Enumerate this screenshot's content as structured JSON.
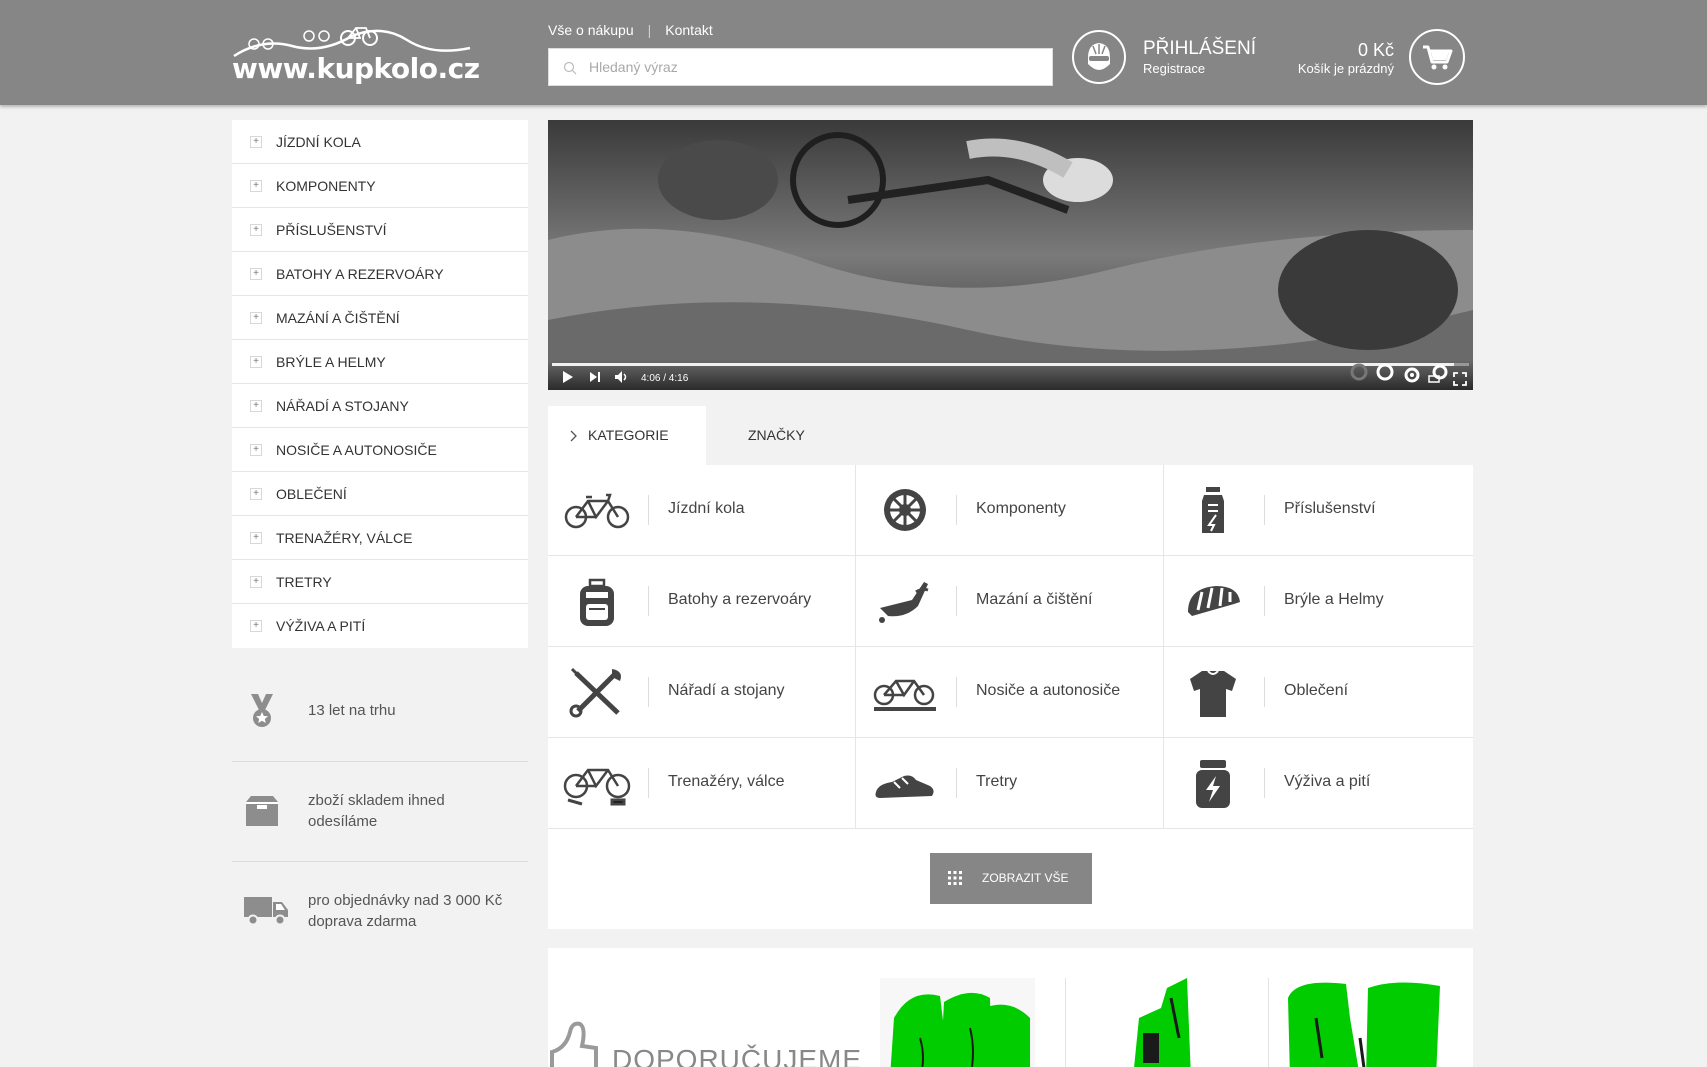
{
  "header": {
    "logo_text": "www.kupkolo.cz",
    "links": [
      "Vše o nákupu",
      "Kontakt"
    ],
    "search_placeholder": "Hledaný výraz",
    "login_title": "PŘIHLÁŠENÍ",
    "register_label": "Registrace",
    "cart_price": "0 Kč",
    "cart_status": "Košík je prázdný"
  },
  "sidebar": {
    "menu": [
      "JÍZDNÍ KOLA",
      "KOMPONENTY",
      "PŘÍSLUŠENSTVÍ",
      "BATOHY A REZERVOÁRY",
      "MAZÁNÍ A ČIŠTĚNÍ",
      "BRÝLE A HELMY",
      "NÁŘADÍ A STOJANY",
      "NOSIČE A AUTONOSIČE",
      "OBLEČENÍ",
      "TRENAŽÉRY, VÁLCE",
      "TRETRY",
      "VÝŽIVA A PITÍ"
    ],
    "usp": [
      {
        "icon": "medal-icon",
        "lines": [
          "13 let na trhu"
        ]
      },
      {
        "icon": "box-icon",
        "lines": [
          "zboží skladem ihned",
          "odesíláme"
        ]
      },
      {
        "icon": "truck-icon",
        "lines": [
          "pro objednávky nad 3 000 Kč",
          "doprava zdarma"
        ]
      }
    ]
  },
  "video": {
    "time": "4:06 / 4:16",
    "progress": 0.984
  },
  "tabs": {
    "active": "KATEGORIE",
    "other": "ZNAČKY"
  },
  "categories": [
    {
      "label": "Jízdní kola",
      "icon": "bicycle-icon"
    },
    {
      "label": "Komponenty",
      "icon": "chainring-icon"
    },
    {
      "label": "Příslušenství",
      "icon": "bottle-icon"
    },
    {
      "label": "Batohy a rezervoáry",
      "icon": "backpack-icon"
    },
    {
      "label": "Mazání a čištění",
      "icon": "oil-can-icon"
    },
    {
      "label": "Brýle a Helmy",
      "icon": "helmet-icon"
    },
    {
      "label": "Nářadí a stojany",
      "icon": "tools-icon"
    },
    {
      "label": "Nosiče a autonosiče",
      "icon": "bike-rack-icon"
    },
    {
      "label": "Oblečení",
      "icon": "jersey-icon"
    },
    {
      "label": "Trenažéry, válce",
      "icon": "trainer-icon"
    },
    {
      "label": "Tretry",
      "icon": "shoe-icon"
    },
    {
      "label": "Výživa a pití",
      "icon": "nutrition-icon"
    }
  ],
  "show_all_label": "ZOBRAZIT VŠE",
  "recommend": {
    "title": "DOPORUČUJEME"
  },
  "colors": {
    "header_bg": "#858685",
    "page_bg": "#f1f2f1",
    "button_bg": "#858685",
    "product_placeholder": "#00cc00"
  }
}
